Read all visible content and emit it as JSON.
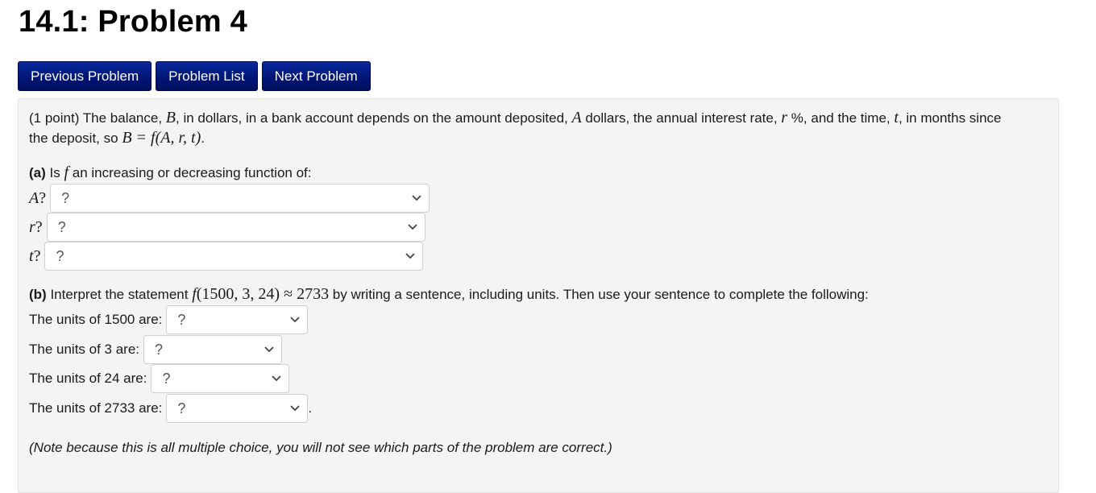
{
  "page_title": "14.1: Problem 4",
  "nav": {
    "previous": "Previous Problem",
    "list": "Problem List",
    "next": "Next Problem"
  },
  "problem": {
    "intro_points": "(1 point) The balance, ",
    "var_B": "B",
    "intro_1": ", in dollars, in a bank account depends on the amount deposited, ",
    "var_A": "A",
    "intro_2": " dollars, the annual interest rate, ",
    "var_r": "r",
    "intro_3": " %, and the time, ",
    "var_t": "t",
    "intro_4": ", in months since",
    "intro_line2_prefix": "the deposit, so ",
    "formula": "B = f(A, r, t)",
    "intro_line2_suffix": ".",
    "part_a": {
      "label": "(a)",
      "text_1": " Is ",
      "var_f": "f",
      "text_2": " an increasing or decreasing function of:",
      "rows": [
        {
          "var": "A",
          "suffix": "?",
          "selected": "?"
        },
        {
          "var": "r",
          "suffix": "?",
          "selected": "?"
        },
        {
          "var": "t",
          "suffix": "?",
          "selected": "?"
        }
      ]
    },
    "part_b": {
      "label": "(b)",
      "text_1": " Interpret the statement ",
      "statement_f": "f",
      "statement_args": "(1500, 3, 24)",
      "approx": " ≈ ",
      "statement_value": "2733",
      "text_2": " by writing a sentence, including units. Then use your sentence to complete the following:",
      "rows": [
        {
          "label": "The units of 1500 are:",
          "selected": "?",
          "trailing": ""
        },
        {
          "label": "The units of 3 are:",
          "selected": "?",
          "trailing": ""
        },
        {
          "label": "The units of 24 are:",
          "selected": "?",
          "trailing": ""
        },
        {
          "label": "The units of 2733 are:",
          "selected": "?",
          "trailing": "."
        }
      ]
    },
    "note": "(Note because this is all multiple choice, you will not see which parts of the problem are correct.)"
  }
}
